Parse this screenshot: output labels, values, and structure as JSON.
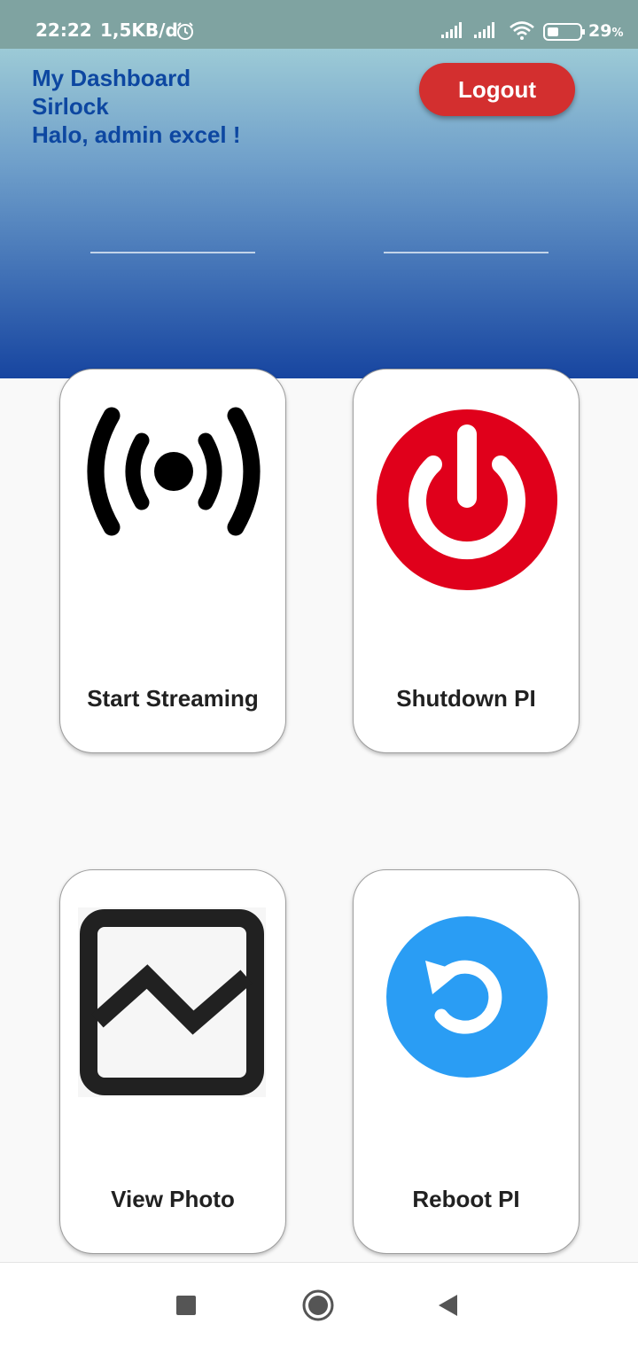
{
  "status_bar": {
    "time": "22:22",
    "network_speed": "1,5KB/d",
    "battery_percent": "29",
    "battery_unit": "%",
    "icons": [
      "alarm-icon",
      "signal-icon",
      "signal-icon",
      "wifi-icon",
      "battery-icon"
    ]
  },
  "header": {
    "line1": "My Dashboard",
    "line2": "Sirlock",
    "greeting": "Halo, admin excel !",
    "logout_label": "Logout",
    "gradient_colors": [
      "#9ccad6",
      "#1745a0"
    ]
  },
  "cards": [
    {
      "label": "Start Streaming",
      "icon": "broadcast-icon"
    },
    {
      "label": "Shutdown PI",
      "icon": "power-icon",
      "color": "#e0001b"
    },
    {
      "label": "View Photo",
      "icon": "photo-icon"
    },
    {
      "label": "Reboot PI",
      "icon": "reboot-icon",
      "color": "#2a9df4"
    }
  ],
  "nav_bar": {
    "icons": [
      "recents-icon",
      "home-icon",
      "back-icon"
    ]
  },
  "colors": {
    "title_text": "#0d47a1",
    "logout_button": "#d32f2f",
    "status_bar": "#7fa3a1",
    "page_background": "#f9f9f9"
  }
}
